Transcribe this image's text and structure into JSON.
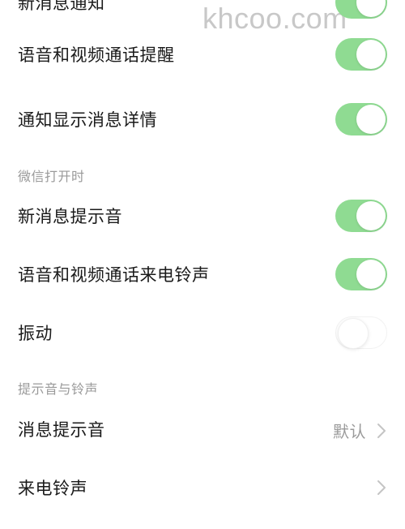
{
  "watermark": "khcoo.com",
  "colors": {
    "toggle_on": "#8fdb92",
    "toggle_off": "#ffffff",
    "section_header": "#9a9a9a",
    "value_text": "#9a9a9a",
    "chevron": "#c4c4c4"
  },
  "rows": [
    {
      "label": "新消息通知",
      "toggle": true
    },
    {
      "label": "语音和视频通话提醒",
      "toggle": true
    },
    {
      "label": "通知显示消息详情",
      "toggle": true
    }
  ],
  "sections": [
    {
      "header": "微信打开时",
      "rows": [
        {
          "label": "新消息提示音",
          "toggle": true
        },
        {
          "label": "语音和视频通话来电铃声",
          "toggle": true
        },
        {
          "label": "振动",
          "toggle": false
        }
      ]
    },
    {
      "header": "提示音与铃声",
      "rows": [
        {
          "label": "消息提示音",
          "value": "默认",
          "icon": "chevron-right-icon"
        },
        {
          "label": "来电铃声",
          "value": "",
          "icon": "chevron-right-icon"
        }
      ]
    }
  ]
}
